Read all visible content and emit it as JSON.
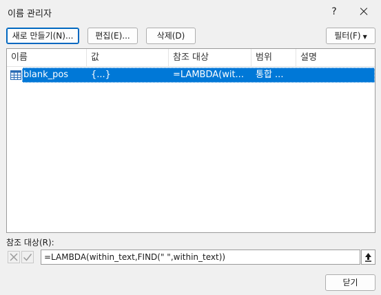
{
  "window": {
    "title": "이름 관리자",
    "help_label": "?"
  },
  "toolbar": {
    "new_label": "새로 만들기(N)...",
    "edit_label": "편집(E)...",
    "delete_label": "삭제(D)",
    "filter_label": "필터(F)"
  },
  "table": {
    "columns": [
      "이름",
      "값",
      "참조 대상",
      "범위",
      "설명"
    ],
    "rows": [
      {
        "name": "blank_pos",
        "value": "{...}",
        "refers_to": "=LAMBDA(wit...",
        "scope": "통합 ...",
        "comment": ""
      }
    ]
  },
  "refers_to": {
    "label": "참조 대상(R):",
    "value": "=LAMBDA(within_text,FIND(\" \",within_text))"
  },
  "footer": {
    "close_label": "닫기"
  },
  "colors": {
    "selection": "#0078d7",
    "primary_border": "#0067c0",
    "background": "#f0f0f0"
  }
}
